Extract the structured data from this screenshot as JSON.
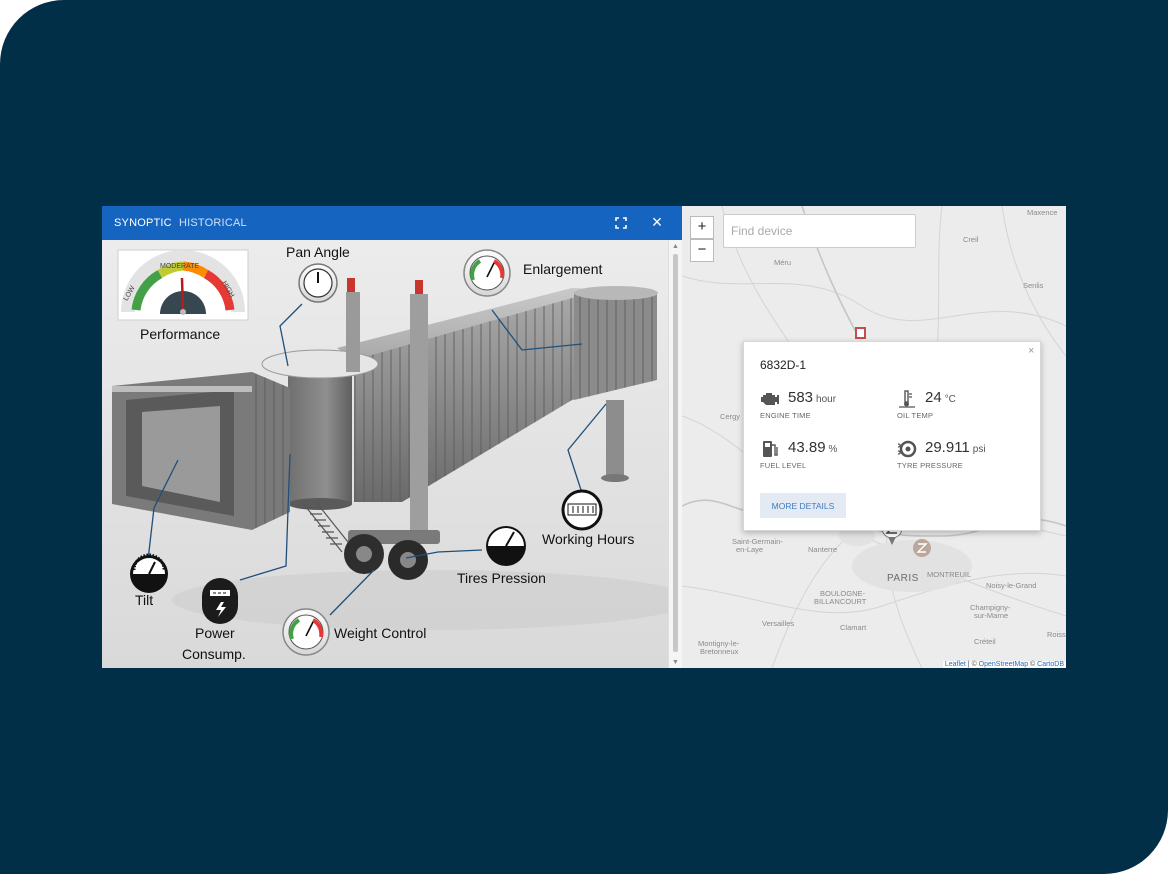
{
  "tabs": [
    {
      "label": "SYNOPTIC",
      "active": true
    },
    {
      "label": "HISTORICAL",
      "active": false
    }
  ],
  "header": {
    "close_label": "×"
  },
  "synoptic": {
    "labels": {
      "pan_angle": "Pan Angle",
      "enlargement": "Enlargement",
      "performance": "Performance",
      "working_hours": "Working Hours",
      "tires_pression": "Tires Pression",
      "tilt": "Tilt",
      "weight_control": "Weight Control",
      "power": "Power",
      "consump": "Consump."
    },
    "performance_gauge": {
      "low": "LOW",
      "moderate": "MODERATE",
      "high": "HIGH"
    }
  },
  "map": {
    "zoom_in": "+",
    "zoom_out": "−",
    "search_placeholder": "Find device",
    "towns": {
      "maxence": "Maxence",
      "creil": "Creil",
      "meru": "Méru",
      "senlis": "Senlis",
      "cergy": "Cergy",
      "saint_germain_1": "Saint-Germain-",
      "saint_germain_2": "en-Laye",
      "nanterre": "Nanterre",
      "paris": "PARIS",
      "montreuil": "MONTREUIL",
      "noisy": "Noisy-le-Grand",
      "boulogne_1": "BOULOGNE-",
      "boulogne_2": "BILLANCOURT",
      "versailles": "Versailles",
      "clamart": "Clamart",
      "champigny_1": "Champigny-",
      "champigny_2": "sur-Marne",
      "creteil": "Créteil",
      "montigny_1": "Montigny-le-",
      "montigny_2": "Bretonneux",
      "roissy": "Roiss"
    },
    "popup": {
      "close": "×",
      "device": "6832D-1",
      "metrics": [
        {
          "value": "583",
          "unit": "hour",
          "label": "ENGINE TIME",
          "icon": "engine-icon"
        },
        {
          "value": "24",
          "unit": "°C",
          "label": "OIL TEMP",
          "icon": "thermometer-icon"
        },
        {
          "value": "43.89",
          "unit": "%",
          "label": "FUEL LEVEL",
          "icon": "fuel-pump-icon"
        },
        {
          "value": "29.911",
          "unit": "psi",
          "label": "TYRE PRESSURE",
          "icon": "tyre-icon"
        }
      ],
      "button": "MORE DETAILS"
    },
    "attribution": {
      "leaflet": "Leaflet",
      "sep1": " | © ",
      "osm": "OpenStreetMap",
      "sep2": " © ",
      "carto": "CartoDB"
    }
  },
  "colors": {
    "background": "#002f47",
    "header": "#1565c0",
    "accent": "#3d7bbf",
    "marker_active": "#c44d4d"
  }
}
